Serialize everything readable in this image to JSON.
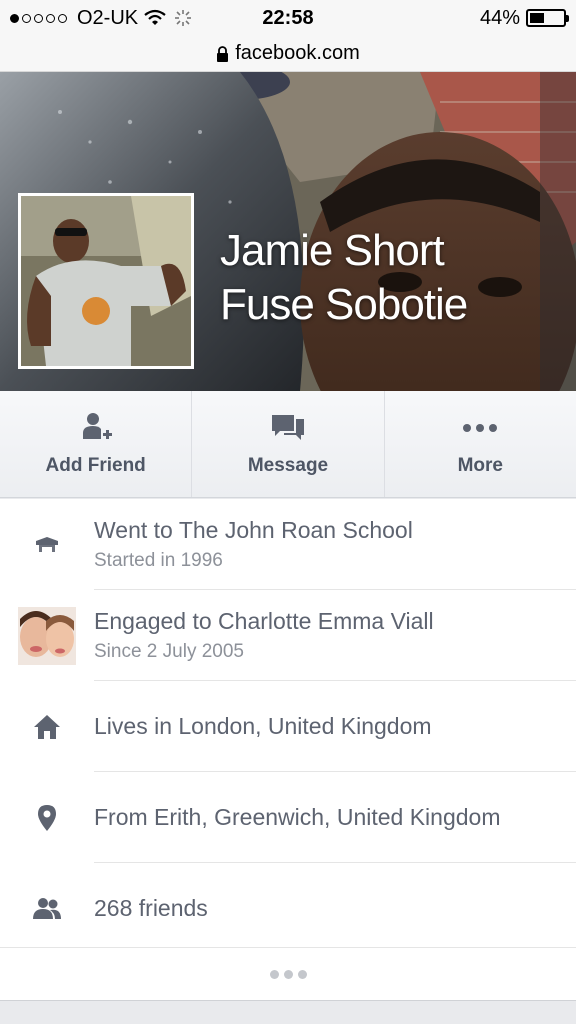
{
  "status_bar": {
    "carrier": "O2-UK",
    "time": "22:58",
    "battery_percent": "44%",
    "battery_level": 0.44,
    "signal_bars_filled": 1,
    "signal_bars_total": 5
  },
  "browser": {
    "url": "facebook.com"
  },
  "profile": {
    "name_line1": "Jamie Short",
    "name_line2": "Fuse Sobotie"
  },
  "actions": [
    {
      "label": "Add Friend",
      "icon": "add-friend-icon"
    },
    {
      "label": "Message",
      "icon": "message-icon"
    },
    {
      "label": "More",
      "icon": "more-icon"
    }
  ],
  "info": [
    {
      "icon": "education-icon",
      "primary": "Went to The John Roan School",
      "secondary": "Started in 1996"
    },
    {
      "icon": "relationship-photo",
      "primary": "Engaged to Charlotte Emma Viall",
      "secondary": "Since 2 July 2005"
    },
    {
      "icon": "home-icon",
      "primary": "Lives in London, United Kingdom"
    },
    {
      "icon": "location-pin-icon",
      "primary": "From Erith, Greenwich, United Kingdom"
    },
    {
      "icon": "friends-icon",
      "primary": "268 friends"
    }
  ],
  "colors": {
    "icon_gray": "#5d6370",
    "cover_dark": "#3b3f45"
  }
}
